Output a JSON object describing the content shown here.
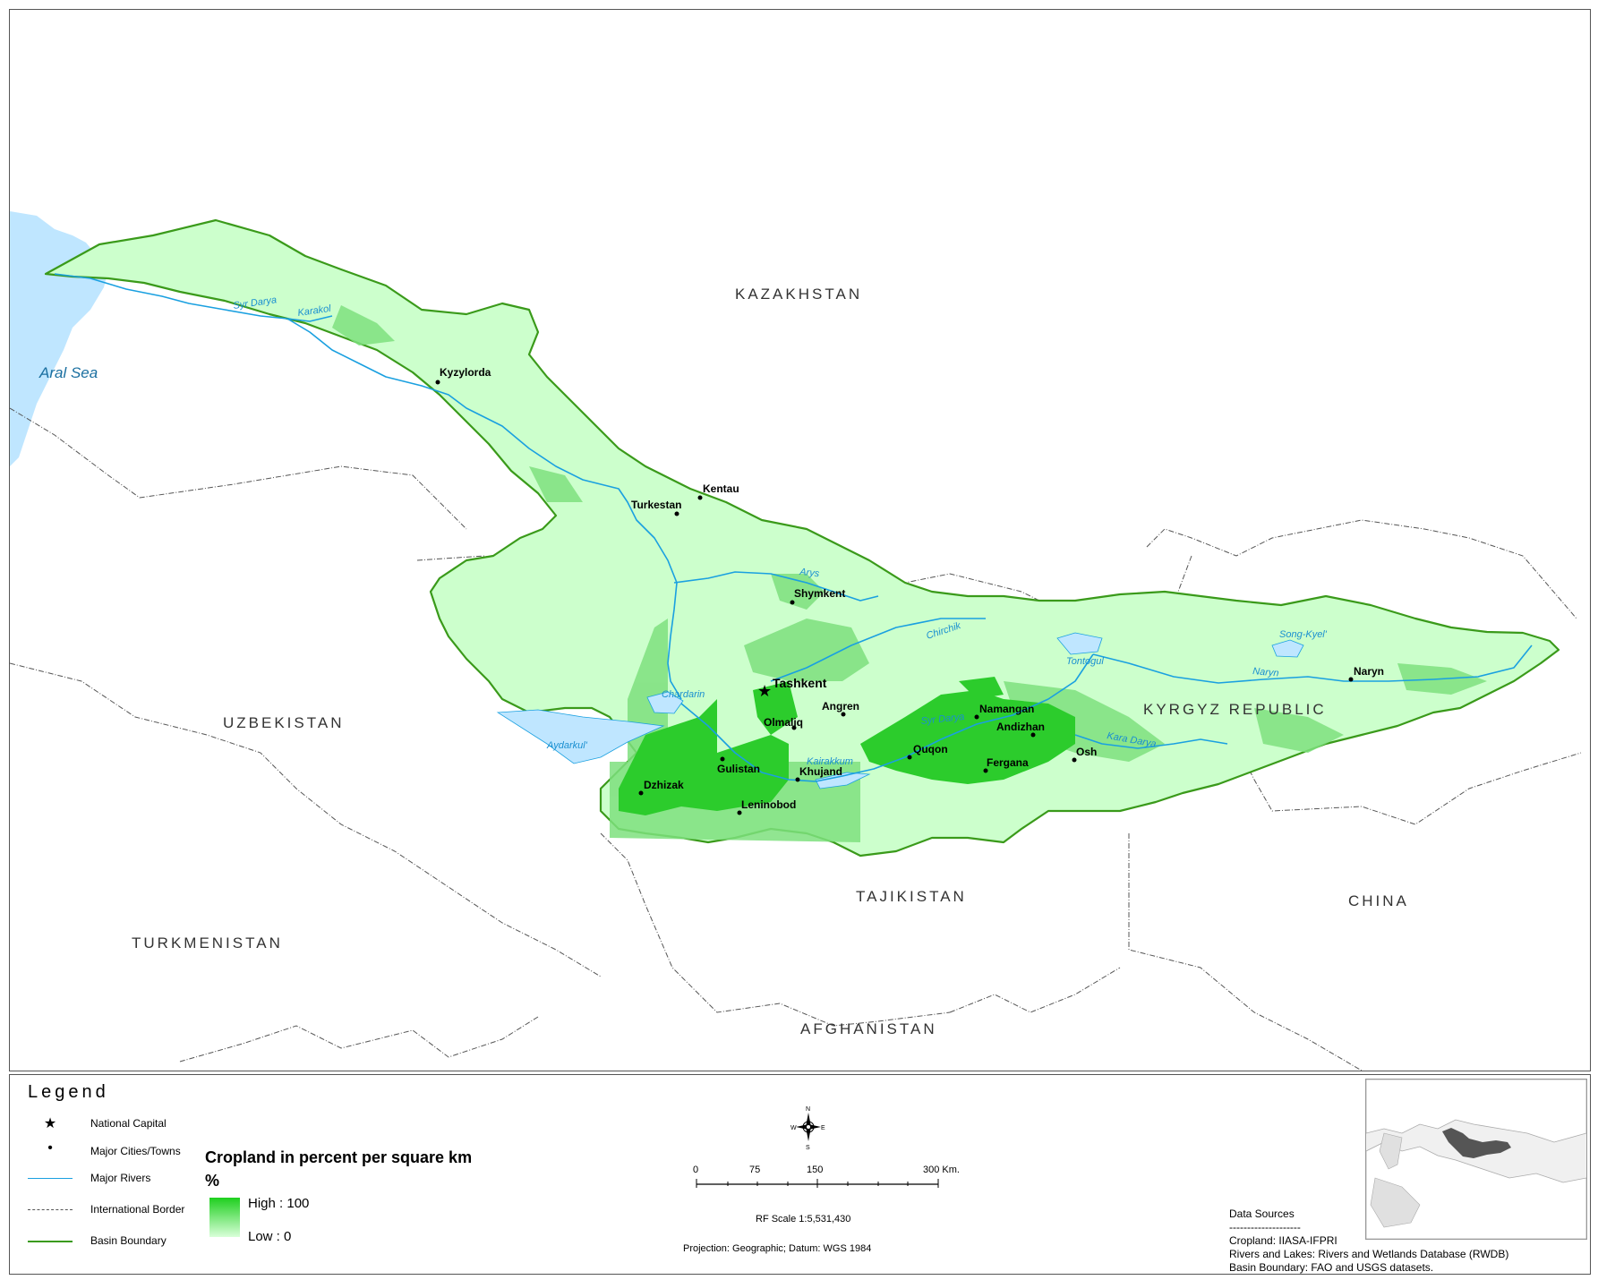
{
  "map": {
    "countries": [
      "KAZAKHSTAN",
      "UZBEKISTAN",
      "KYRGYZ REPUBLIC",
      "TAJIKISTAN",
      "TURKMENISTAN",
      "AFGHANISTAN",
      "CHINA"
    ],
    "water_bodies": [
      "Aral Sea",
      "Aydarkul'",
      "Chardarin",
      "Kairakkum",
      "Tontogul",
      "Song-Kyel'"
    ],
    "rivers": [
      "Syr Darya",
      "Karakol",
      "Arys",
      "Chirchik",
      "Syr Darya",
      "Naryn",
      "Kara Darya"
    ],
    "capital": "Tashkent",
    "cities": [
      "Kyzylorda",
      "Kentau",
      "Turkestan",
      "Shymkent",
      "Angren",
      "Olmaliq",
      "Namangan",
      "Andizhan",
      "Quqon",
      "Fergana",
      "Osh",
      "Gulistan",
      "Khujand",
      "Dzhizak",
      "Leninobod",
      "Naryn"
    ]
  },
  "legend": {
    "title": "Legend",
    "national_capital": "National Capital",
    "major_cities": "Major Cities/Towns",
    "major_rivers": "Major Rivers",
    "international_border": "International Border",
    "basin_boundary": "Basin Boundary",
    "cropland_title": "Cropland in percent per square km",
    "cropland_unit": "%",
    "high": "High : 100",
    "low": "Low : 0"
  },
  "scale_bar": {
    "ticks": [
      "0",
      "75",
      "150",
      "300 Km."
    ],
    "rf_scale": "RF Scale 1:5,531,430",
    "projection": "Projection: Geographic; Datum: WGS 1984"
  },
  "compass": {
    "n": "N",
    "s": "S",
    "e": "E",
    "w": "W"
  },
  "data_sources": {
    "title": "Data Sources",
    "rule": "--------------------",
    "cropland": "Cropland: IIASA-IFPRI",
    "rivers": "Rivers and Lakes: Rivers and Wetlands Database (RWDB)",
    "basin": "Basin Boundary: FAO and USGS datasets."
  },
  "colors": {
    "basin_fill": "#ccffcc",
    "crop_medium": "#7ee07e",
    "crop_high": "#2ccc2c",
    "basin_boundary": "#3a9a1a",
    "river": "#1aa0e0",
    "water": "#bfe6ff",
    "border": "#555555"
  }
}
